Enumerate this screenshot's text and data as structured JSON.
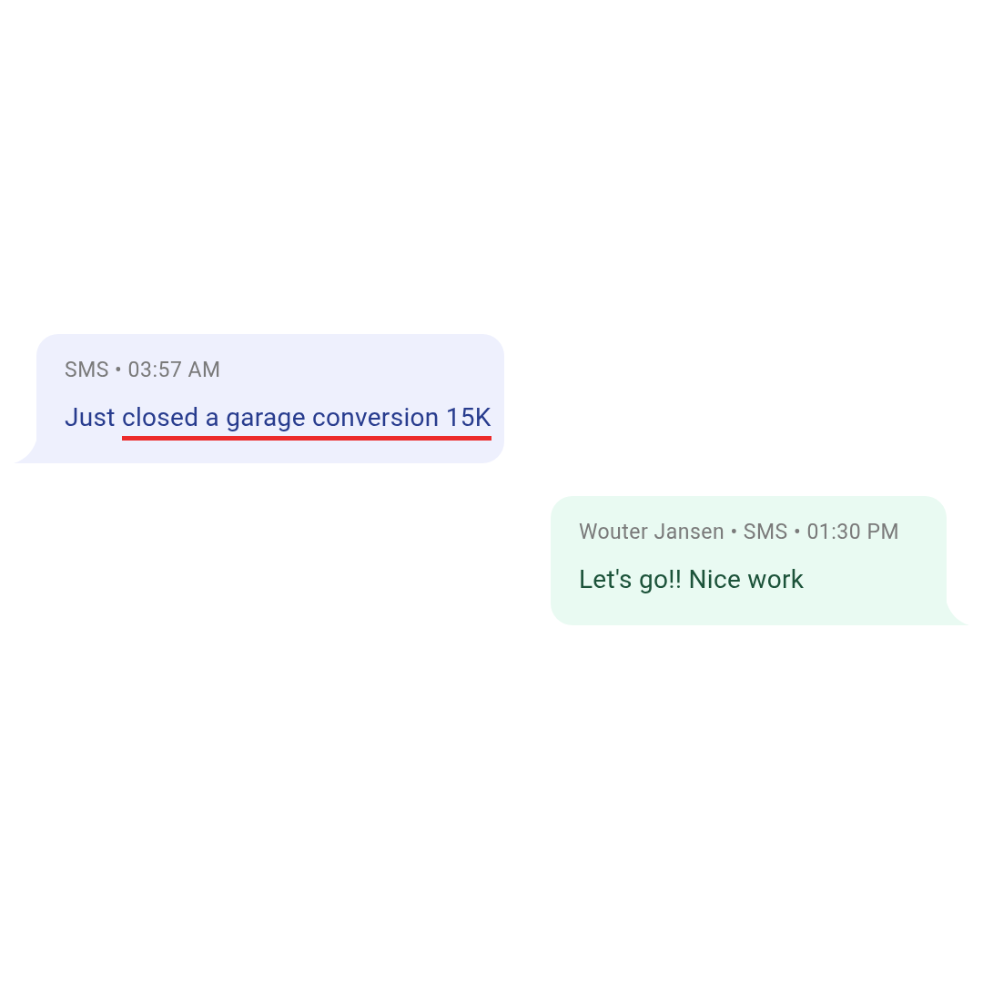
{
  "messages": [
    {
      "kind": "incoming",
      "meta": "SMS • 03:57 AM",
      "segments": [
        {
          "text": "Just ",
          "underlined": false
        },
        {
          "text": "closed a garage conversion 15K",
          "underlined": true
        }
      ]
    },
    {
      "kind": "outgoing",
      "meta": "Wouter Jansen • SMS • 01:30 PM",
      "segments": [
        {
          "text": "Let's go!! Nice work",
          "underlined": false
        }
      ]
    }
  ]
}
